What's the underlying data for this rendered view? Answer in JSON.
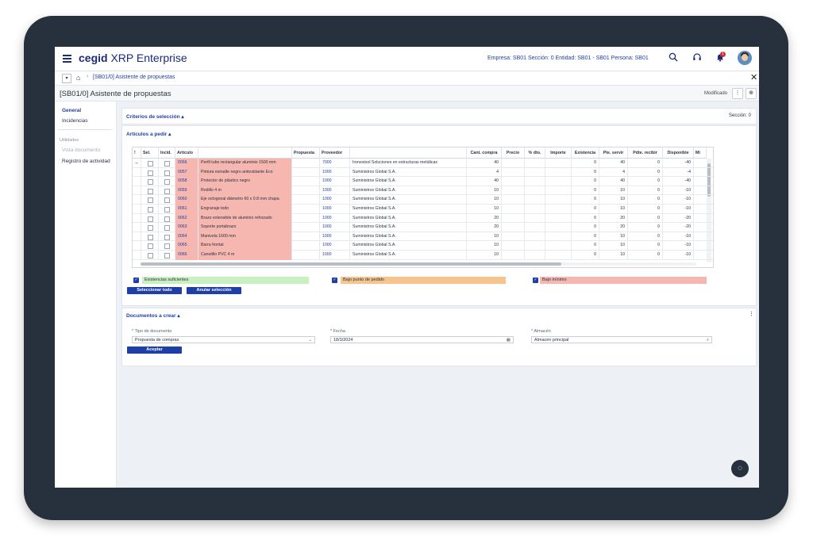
{
  "app": {
    "logo_brand": "cegid",
    "logo_product": "XRP Enterprise"
  },
  "topbar": {
    "context": "Empresa: SB01 Sección: 0 Entidad: SB01 - SB01 Persona: SB01",
    "notifications_count": "1",
    "icons": [
      "menu-icon",
      "search-icon",
      "headset-icon",
      "bell-icon",
      "avatar"
    ]
  },
  "breadcrumb": {
    "path": "[SB01/0] Asistente de propuestas"
  },
  "page": {
    "title": "[SB01/0] Asistente de propuestas",
    "status": "Modificado"
  },
  "sidebar": {
    "items": [
      {
        "label": "General",
        "active": true
      },
      {
        "label": "Incidencias"
      }
    ],
    "utilities_heading": "Utilidades",
    "utilities": [
      {
        "label": "Vista documento",
        "disabled": true
      },
      {
        "label": "Registro de actividad"
      }
    ]
  },
  "criteria": {
    "title": "Criterios de selección",
    "section": "Sección: 0"
  },
  "articles": {
    "title": "Artículos a pedir",
    "columns": [
      "!",
      "Sel.",
      "Incid.",
      "Artículo",
      "",
      "Propuesta",
      "Proveedor",
      "",
      "Cant. compra",
      "Precio",
      "% dto.",
      "Importe",
      "Existencia",
      "Pte. servir",
      "Pdte. recibir",
      "Disponible",
      "Mí"
    ],
    "rows": [
      {
        "arrow": "→",
        "code": "0056",
        "desc": "Perfil tubo rectangular aluminio 1500 mm",
        "prov": "7000",
        "prov_name": "Ironestsol Soluciones en estructuras metálicas",
        "cant": "40",
        "exist": "0",
        "pte": "40",
        "pdte": "0",
        "disp": "-40"
      },
      {
        "arrow": "",
        "code": "0057",
        "desc": "Pintura esmalte negro antioxidante Eco",
        "prov": "1000",
        "prov_name": "Suministros Global S.A.",
        "cant": "4",
        "exist": "0",
        "pte": "4",
        "pdte": "0",
        "disp": "-4"
      },
      {
        "arrow": "",
        "code": "0058",
        "desc": "Protector de plástico negro",
        "prov": "1000",
        "prov_name": "Suministros Global S.A.",
        "cant": "40",
        "exist": "0",
        "pte": "40",
        "pdte": "0",
        "disp": "-40"
      },
      {
        "arrow": "",
        "code": "0059",
        "desc": "Rodillo 4 m",
        "prov": "1000",
        "prov_name": "Suministros Global S.A.",
        "cant": "10",
        "exist": "0",
        "pte": "10",
        "pdte": "0",
        "disp": "-10"
      },
      {
        "arrow": "",
        "code": "0060",
        "desc": "Eje octogonal diámetro 60 x 0.8 mm chapa",
        "prov": "1000",
        "prov_name": "Suministros Global S.A.",
        "cant": "10",
        "exist": "0",
        "pte": "10",
        "pdte": "0",
        "disp": "-10"
      },
      {
        "arrow": "",
        "code": "0061",
        "desc": "Engranaje todo",
        "prov": "1000",
        "prov_name": "Suministros Global S.A.",
        "cant": "10",
        "exist": "0",
        "pte": "10",
        "pdte": "0",
        "disp": "-10"
      },
      {
        "arrow": "",
        "code": "0062",
        "desc": "Brazo extensible de aluminio reforzado",
        "prov": "1000",
        "prov_name": "Suministros Global S.A.",
        "cant": "20",
        "exist": "0",
        "pte": "20",
        "pdte": "0",
        "disp": "-20"
      },
      {
        "arrow": "",
        "code": "0063",
        "desc": "Soporte portabrazo",
        "prov": "1000",
        "prov_name": "Suministros Global S.A.",
        "cant": "20",
        "exist": "0",
        "pte": "20",
        "pdte": "0",
        "disp": "-20"
      },
      {
        "arrow": "",
        "code": "0064",
        "desc": "Manivela 1600 mm",
        "prov": "1000",
        "prov_name": "Suministros Global S.A.",
        "cant": "10",
        "exist": "0",
        "pte": "10",
        "pdte": "0",
        "disp": "-10"
      },
      {
        "arrow": "",
        "code": "0065",
        "desc": "Barra frontal",
        "prov": "1000",
        "prov_name": "Suministros Global S.A.",
        "cant": "10",
        "exist": "0",
        "pte": "10",
        "pdte": "0",
        "disp": "-10"
      },
      {
        "arrow": "",
        "code": "0066",
        "desc": "Canutillo PVC 4 m",
        "prov": "1000",
        "prov_name": "Suministros Global S.A.",
        "cant": "10",
        "exist": "0",
        "pte": "10",
        "pdte": "0",
        "disp": "-10"
      }
    ]
  },
  "legend": [
    {
      "label": "Existencias suficientes",
      "color": "#c8f0c0"
    },
    {
      "label": "Bajo punto de pedido",
      "color": "#f7c48e"
    },
    {
      "label": "Bajo mínimo",
      "color": "#f6b7b0"
    }
  ],
  "actions": {
    "select_all": "Seleccionar todo",
    "clear_selection": "Anular selección"
  },
  "documents": {
    "title": "Documentos a crear",
    "doc_type_label": "* Tipo de documento",
    "doc_type_value": "Propuesta de compras",
    "date_label": "* Fecha",
    "date_value": "18/3/2024",
    "warehouse_label": "* Almacén",
    "warehouse_value": "Almacén principal",
    "accept": "Aceptar"
  },
  "colors": {
    "accent": "#1f3fa8",
    "bezel": "#26313d",
    "row_highlight": "#f6b7b0"
  }
}
